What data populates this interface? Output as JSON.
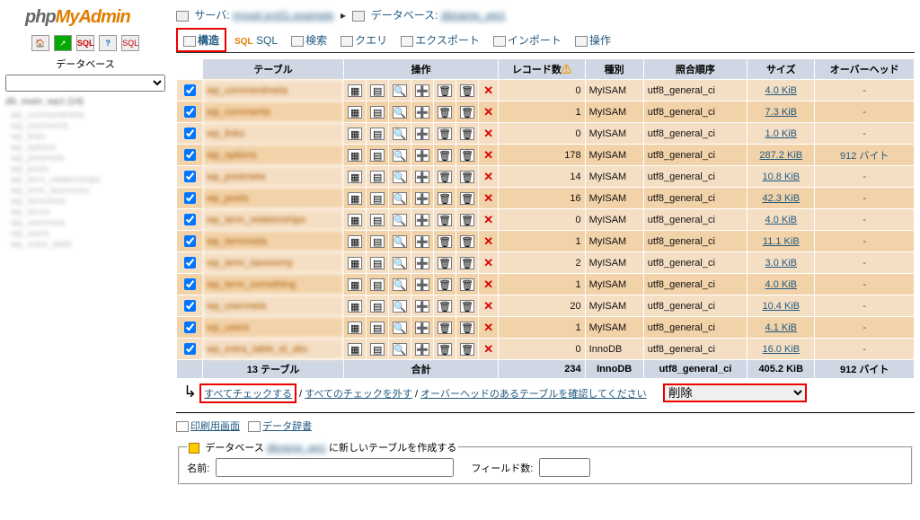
{
  "logo": {
    "p1": "php",
    "p2": "My",
    "p3": "Admin"
  },
  "sidebar": {
    "db_label": "データベース",
    "mini_icons": [
      "home-icon",
      "exit-icon",
      "sql-icon",
      "help-icon",
      "sql-window-icon"
    ],
    "tree_head1": "db_main_wp1 (14)",
    "tree_items": [
      "wp_commentmeta",
      "wp_comments",
      "wp_links",
      "wp_options",
      "wp_postmeta",
      "wp_posts",
      "wp_term_relationships",
      "wp_term_taxonomy",
      "wp_termmeta",
      "wp_terms",
      "wp_usermeta",
      "wp_users",
      "wp_extra_table"
    ]
  },
  "breadcrumb": {
    "server_label": "サーバ:",
    "server_value": "mysql.srv01.example",
    "db_label": "データベース:",
    "db_value": "dbname_wp1"
  },
  "tabs": {
    "structure": "構造",
    "sql": "SQL",
    "search": "検索",
    "query": "クエリ",
    "export": "エクスポート",
    "import": "インポート",
    "operations": "操作"
  },
  "headers": {
    "table": "テーブル",
    "action": "操作",
    "records": "レコード数",
    "type": "種別",
    "collation": "照合順序",
    "size": "サイズ",
    "overhead": "オーバーヘッド"
  },
  "rows": [
    {
      "name": "wp_commentmeta",
      "records": "0",
      "type": "MyISAM",
      "collation": "utf8_general_ci",
      "size": "4.0 KiB",
      "overhead": "-"
    },
    {
      "name": "wp_comments",
      "records": "1",
      "type": "MyISAM",
      "collation": "utf8_general_ci",
      "size": "7.3 KiB",
      "overhead": "-"
    },
    {
      "name": "wp_links",
      "records": "0",
      "type": "MyISAM",
      "collation": "utf8_general_ci",
      "size": "1.0 KiB",
      "overhead": "-"
    },
    {
      "name": "wp_options",
      "records": "178",
      "type": "MyISAM",
      "collation": "utf8_general_ci",
      "size": "287.2 KiB",
      "overhead": "912 バイト"
    },
    {
      "name": "wp_postmeta",
      "records": "14",
      "type": "MyISAM",
      "collation": "utf8_general_ci",
      "size": "10.8 KiB",
      "overhead": "-"
    },
    {
      "name": "wp_posts",
      "records": "16",
      "type": "MyISAM",
      "collation": "utf8_general_ci",
      "size": "42.3 KiB",
      "overhead": "-"
    },
    {
      "name": "wp_term_relationships",
      "records": "0",
      "type": "MyISAM",
      "collation": "utf8_general_ci",
      "size": "4.0 KiB",
      "overhead": "-"
    },
    {
      "name": "wp_termmeta",
      "records": "1",
      "type": "MyISAM",
      "collation": "utf8_general_ci",
      "size": "11.1 KiB",
      "overhead": "-"
    },
    {
      "name": "wp_term_taxonomy",
      "records": "2",
      "type": "MyISAM",
      "collation": "utf8_general_ci",
      "size": "3.0 KiB",
      "overhead": "-"
    },
    {
      "name": "wp_term_something",
      "records": "1",
      "type": "MyISAM",
      "collation": "utf8_general_ci",
      "size": "4.0 KiB",
      "overhead": "-"
    },
    {
      "name": "wp_usermeta",
      "records": "20",
      "type": "MyISAM",
      "collation": "utf8_general_ci",
      "size": "10.4 KiB",
      "overhead": "-"
    },
    {
      "name": "wp_users",
      "records": "1",
      "type": "MyISAM",
      "collation": "utf8_general_ci",
      "size": "4.1 KiB",
      "overhead": "-"
    },
    {
      "name": "wp_extra_table_id_abc",
      "records": "0",
      "type": "InnoDB",
      "collation": "utf8_general_ci",
      "size": "16.0 KiB",
      "overhead": "-"
    }
  ],
  "totals": {
    "count_label": "13 テーブル",
    "sum_label": "合計",
    "records": "234",
    "type": "InnoDB",
    "collation": "utf8_general_ci",
    "size": "405.2 KiB",
    "overhead": "912 バイト"
  },
  "bulk": {
    "check_all": "すべてチェックする",
    "uncheck_all": "すべてのチェックを外す",
    "check_overhead": "オーバーヘッドのあるテーブルを確認してください",
    "action_selected": "削除"
  },
  "footer": {
    "print": "印刷用画面",
    "dict": "データ辞書"
  },
  "create": {
    "legend_prefix": "データベース",
    "legend_db": "dbname_wp1",
    "legend_suffix": "に新しいテーブルを作成する",
    "name_label": "名前:",
    "fields_label": "フィールド数:"
  }
}
